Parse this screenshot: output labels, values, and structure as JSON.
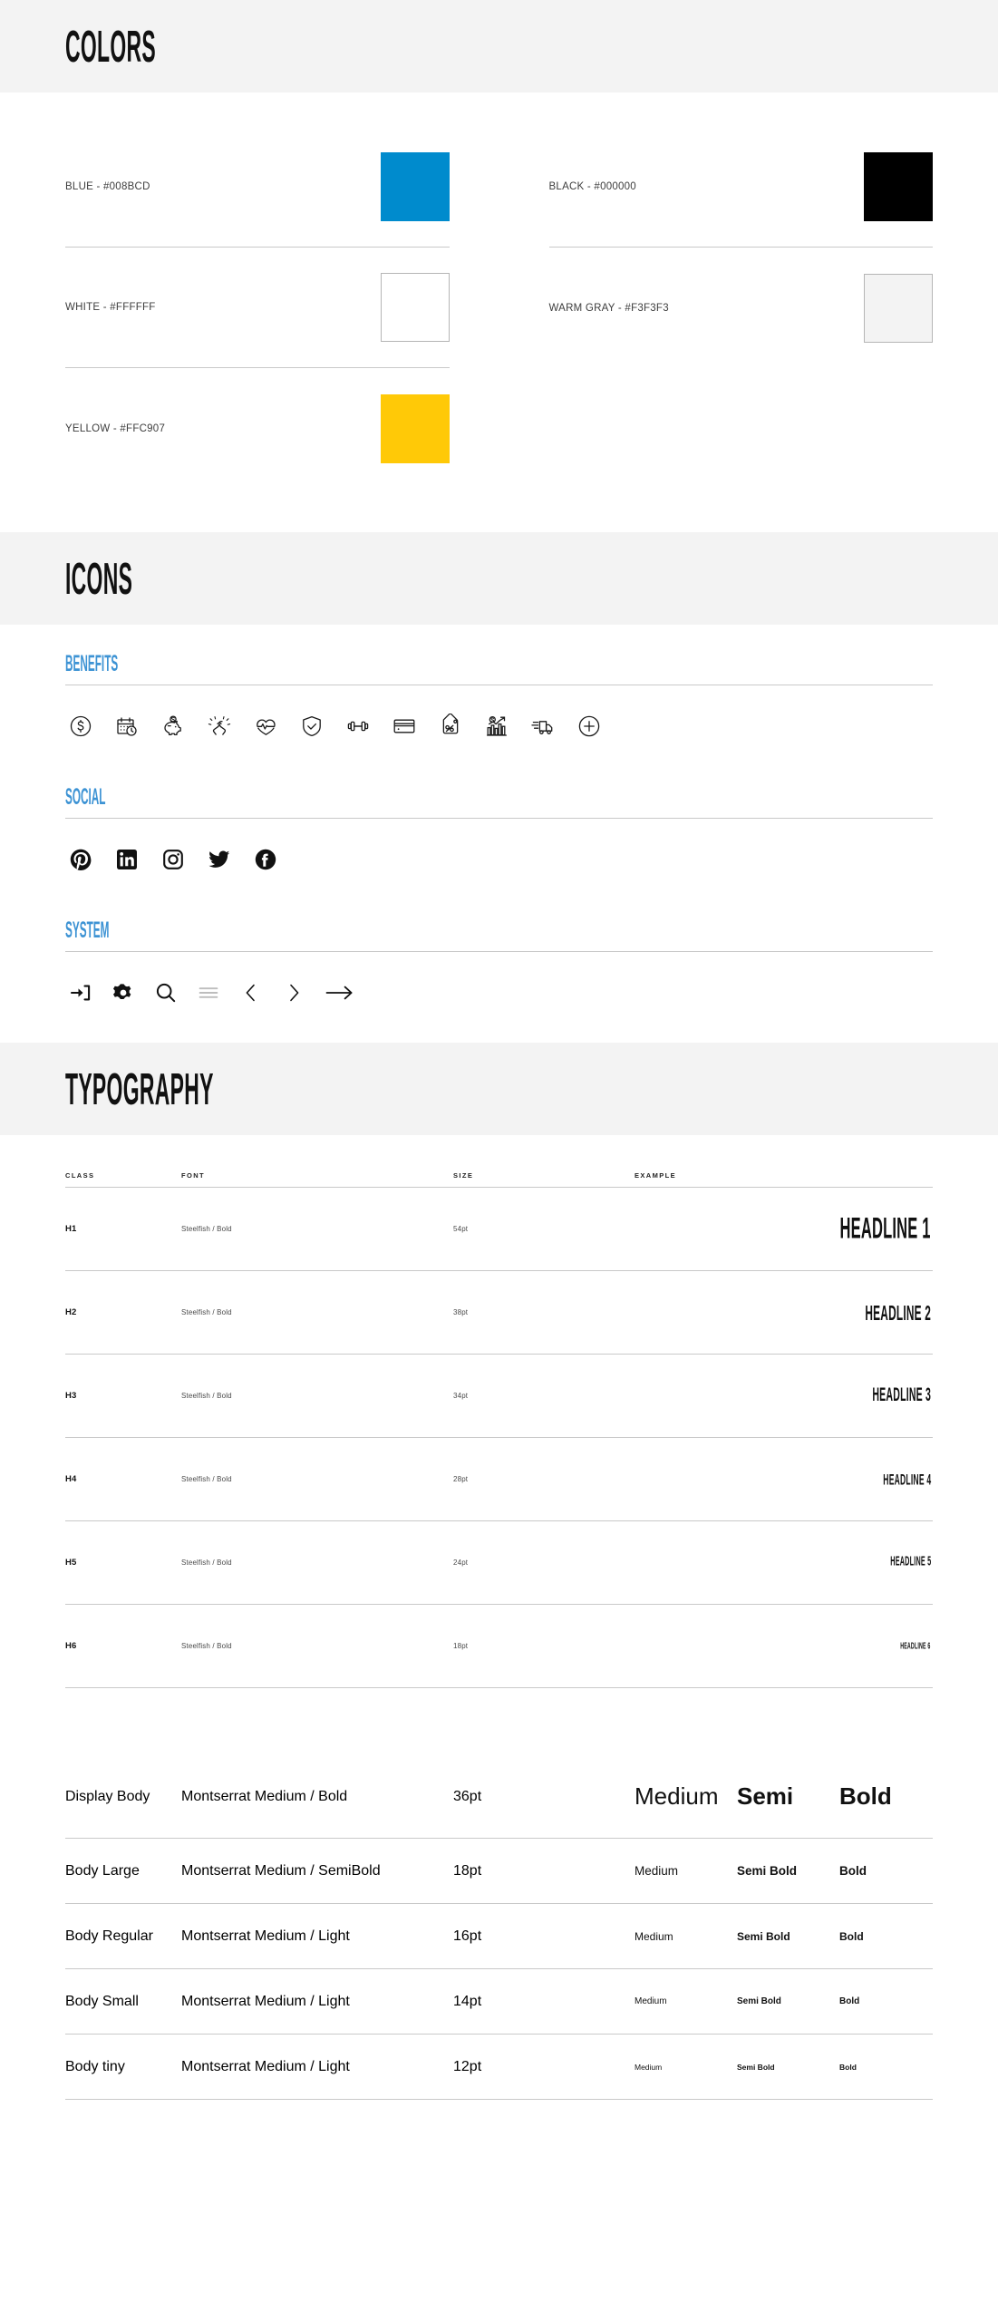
{
  "sections": {
    "colors": {
      "title": "COLORS",
      "items_left": [
        {
          "label": "BLUE - #008BCD",
          "hex": "#008BCD",
          "bordered": false
        },
        {
          "label": "WHITE - #FFFFFF",
          "hex": "#FFFFFF",
          "bordered": true
        },
        {
          "label": "YELLOW - #FFC907",
          "hex": "#FFC907",
          "bordered": false
        }
      ],
      "items_right": [
        {
          "label": "BLACK - #000000",
          "hex": "#000000",
          "bordered": false
        },
        {
          "label": "WARM GRAY - #F3F3F3",
          "hex": "#F3F3F3",
          "bordered": true
        }
      ]
    },
    "icons": {
      "title": "ICONS",
      "groups": [
        {
          "title": "BENEFITS",
          "icons": [
            "dollar-circle-icon",
            "calendar-clock-icon",
            "piggy-bank-icon",
            "handshake-icon",
            "heartbeat-icon",
            "shield-check-icon",
            "dumbbell-icon",
            "credit-card-icon",
            "percent-tag-icon",
            "growth-chart-icon",
            "delivery-truck-icon",
            "plus-circle-icon"
          ]
        },
        {
          "title": "SOCIAL",
          "icons": [
            "pinterest-icon",
            "linkedin-icon",
            "instagram-icon",
            "twitter-icon",
            "facebook-icon"
          ]
        },
        {
          "title": "SYSTEM",
          "icons": [
            "sign-in-icon",
            "gear-icon",
            "search-icon",
            "hamburger-menu-icon",
            "chevron-left-icon",
            "chevron-right-icon",
            "arrow-right-icon"
          ]
        }
      ]
    },
    "typography": {
      "title": "TYPOGRAPHY",
      "columns": [
        "CLASS",
        "FONT",
        "SIZE",
        "EXAMPLE"
      ],
      "headings": [
        {
          "cls": "H1",
          "font": "Steelfish / Bold",
          "size": "54pt",
          "example": "HEADLINE 1"
        },
        {
          "cls": "H2",
          "font": "Steelfish / Bold",
          "size": "38pt",
          "example": "HEADLINE 2"
        },
        {
          "cls": "H3",
          "font": "Steelfish / Bold",
          "size": "34pt",
          "example": "HEADLINE 3"
        },
        {
          "cls": "H4",
          "font": "Steelfish / Bold",
          "size": "28pt",
          "example": "HEADLINE 4"
        },
        {
          "cls": "H5",
          "font": "Steelfish / Bold",
          "size": "24pt",
          "example": "HEADLINE 5"
        },
        {
          "cls": "H6",
          "font": "Steelfish / Bold",
          "size": "18pt",
          "example": "HEADLINE 6"
        }
      ],
      "bodies": [
        {
          "cls": "Display Body",
          "font": "Montserrat  Medium / Bold",
          "size": "36pt",
          "w1": "Medium",
          "w2": "Semi",
          "w3": "Bold"
        },
        {
          "cls": "Body Large",
          "font": "Montserrat  Medium / SemiBold",
          "size": "18pt",
          "w1": "Medium",
          "w2": "Semi Bold",
          "w3": "Bold"
        },
        {
          "cls": "Body Regular",
          "font": "Montserrat  Medium / Light",
          "size": "16pt",
          "w1": "Medium",
          "w2": "Semi Bold",
          "w3": "Bold"
        },
        {
          "cls": "Body Small",
          "font": "Montserrat  Medium / Light",
          "size": "14pt",
          "w1": "Medium",
          "w2": "Semi Bold",
          "w3": "Bold"
        },
        {
          "cls": "Body tiny",
          "font": "Montserrat  Medium / Light",
          "size": "12pt",
          "w1": "Medium",
          "w2": "Semi Bold",
          "w3": "Bold"
        }
      ]
    }
  },
  "palette": {
    "accent_blue": "#3d93d4",
    "brand_blue": "#008BCD",
    "yellow": "#FFC907",
    "warm_gray": "#F3F3F3",
    "rule": "#c9c9c9"
  }
}
